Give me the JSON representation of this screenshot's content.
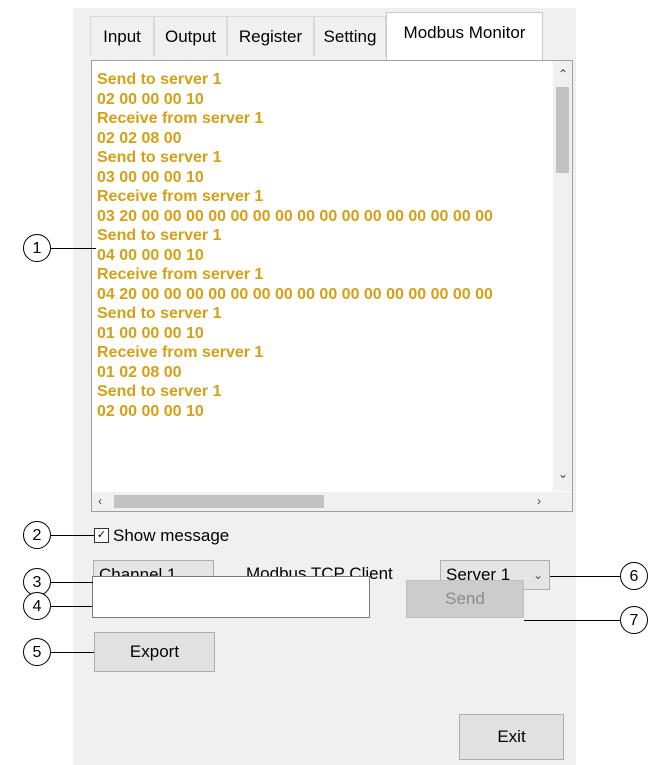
{
  "tabs": [
    "Input",
    "Output",
    "Register",
    "Setting",
    "Modbus Monitor"
  ],
  "active_tab": "Modbus Monitor",
  "log_lines": [
    "Send to server 1",
    "02 00 00 00 10",
    "Receive from server 1",
    "02 02 08 00",
    "Send to server 1",
    "03 00 00 00 10",
    "Receive from server 1",
    "03 20 00 00 00 00 00 00 00 00 00 00 00 00 00 00 00 00",
    "Send to server 1",
    "04 00 00 00 10",
    "Receive from server 1",
    "04 20 00 00 00 00 00 00 00 00 00 00 00 00 00 00 00 00",
    "Send to server 1",
    "01 00 00 00 10",
    "Receive from server 1",
    "01 02 08 00",
    "Send to server 1",
    "02 00 00 00 10"
  ],
  "log_color": "#d4a017",
  "show_message": {
    "label": "Show message",
    "checked": true
  },
  "channel_select": {
    "value": "Channel 1"
  },
  "mode_label": "Modbus TCP Client",
  "server_select": {
    "value": "Server 1"
  },
  "message_input": {
    "value": ""
  },
  "send_button": "Send",
  "export_button": "Export",
  "exit_button": "Exit",
  "callouts": [
    "1",
    "2",
    "3",
    "4",
    "5",
    "6",
    "7"
  ],
  "icons": {
    "up": "scroll-up-arrow-icon",
    "down": "scroll-down-arrow-icon",
    "left": "scroll-left-arrow-icon",
    "right": "scroll-right-arrow-icon",
    "check": "checkmark-icon",
    "chevron": "chevron-down-icon"
  }
}
